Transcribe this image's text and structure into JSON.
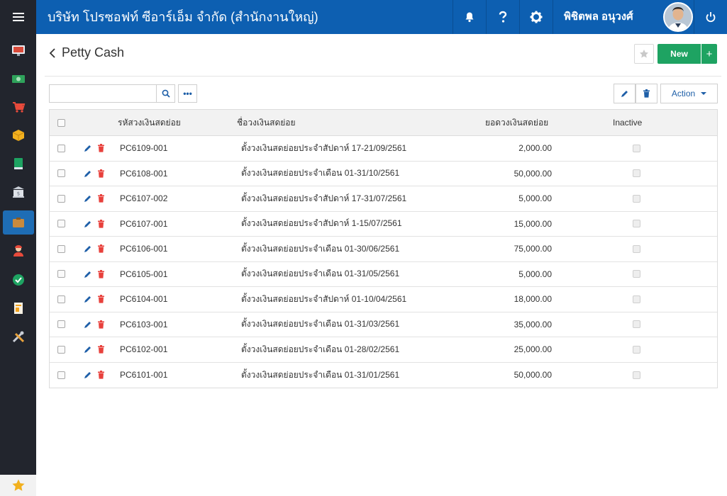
{
  "topbar": {
    "company": "บริษัท โปรซอฟท์ ซีอาร์เอ็ม จำกัด (สำนักงานใหญ่)",
    "user_name": "พิชิตพล อนุวงศ์"
  },
  "page": {
    "title": "Petty Cash",
    "new_label": "New",
    "new_plus": "+"
  },
  "toolbar": {
    "search_placeholder": "",
    "more_label": "•••",
    "action_label": "Action"
  },
  "table": {
    "headers": {
      "code": "รหัสวงเงินสดย่อย",
      "name": "ชื่อวงเงินสดย่อย",
      "amount": "ยอดวงเงินสดย่อย",
      "inactive": "Inactive"
    },
    "rows": [
      {
        "code": "PC6109-001",
        "name": "ตั้งวงเงินสดย่อยประจำสัปดาห์ 17-21/09/2561",
        "amount": "2,000.00"
      },
      {
        "code": "PC6108-001",
        "name": "ตั้งวงเงินสดย่อยประจำเดือน 01-31/10/2561",
        "amount": "50,000.00"
      },
      {
        "code": "PC6107-002",
        "name": "ตั้งวงเงินสดย่อยประจำสัปดาห์ 17-31/07/2561",
        "amount": "5,000.00"
      },
      {
        "code": "PC6107-001",
        "name": "ตั้งวงเงินสดย่อยประจำสัปดาห์ 1-15/07/2561",
        "amount": "15,000.00"
      },
      {
        "code": "PC6106-001",
        "name": "ตั้งวงเงินสดย่อยประจำเดือน 01-30/06/2561",
        "amount": "75,000.00"
      },
      {
        "code": "PC6105-001",
        "name": "ตั้งวงเงินสดย่อยประจำเดือน 01-31/05/2561",
        "amount": "5,000.00"
      },
      {
        "code": "PC6104-001",
        "name": "ตั้งวงเงินสดย่อยประจำสัปดาห์ 01-10/04/2561",
        "amount": "18,000.00"
      },
      {
        "code": "PC6103-001",
        "name": "ตั้งวงเงินสดย่อยประจำเดือน 01-31/03/2561",
        "amount": "35,000.00"
      },
      {
        "code": "PC6102-001",
        "name": "ตั้งวงเงินสดย่อยประจำเดือน 01-28/02/2561",
        "amount": "25,000.00"
      },
      {
        "code": "PC6101-001",
        "name": "ตั้งวงเงินสดย่อยประจำเดือน 01-31/01/2561",
        "amount": "50,000.00"
      }
    ]
  },
  "sidebar": {
    "icons": [
      "dashboard-icon",
      "money-icon",
      "cart-icon",
      "box-icon",
      "book-icon",
      "bank-icon",
      "wallet-icon",
      "person-icon",
      "check-icon",
      "report-icon",
      "tools-icon"
    ],
    "active_index": 6
  },
  "colors": {
    "topbar": "#0d5fb1",
    "sidebar": "#22252d",
    "new_button": "#1ea362",
    "link_blue": "#1e5fa8",
    "delete_red": "#e8413c"
  }
}
